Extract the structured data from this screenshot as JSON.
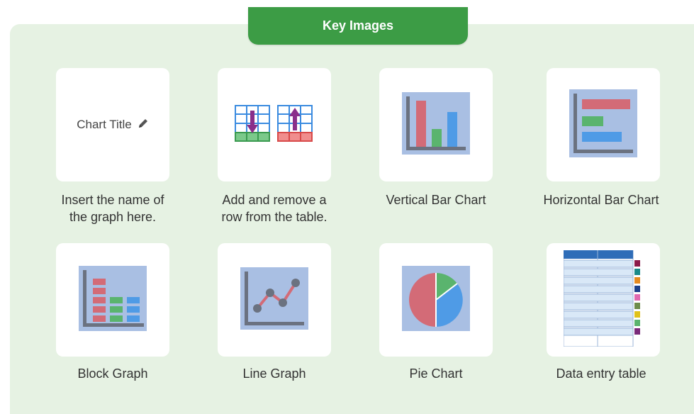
{
  "header": {
    "title": "Key Images"
  },
  "cards": [
    {
      "icon": "pencil-icon",
      "preview_text": "Chart Title",
      "caption_line1": "Insert the name of",
      "caption_line2": "the graph here."
    },
    {
      "icon": "add-remove-row-icon",
      "caption_line1": "Add and remove a",
      "caption_line2": "row from the table."
    },
    {
      "icon": "vertical-bar-chart-icon",
      "caption_line1": "Vertical Bar Chart",
      "caption_line2": ""
    },
    {
      "icon": "horizontal-bar-chart-icon",
      "caption_line1": "Horizontal Bar Chart",
      "caption_line2": ""
    },
    {
      "icon": "block-graph-icon",
      "caption_line1": "Block Graph",
      "caption_line2": ""
    },
    {
      "icon": "line-graph-icon",
      "caption_line1": "Line Graph",
      "caption_line2": ""
    },
    {
      "icon": "pie-chart-icon",
      "caption_line1": "Pie Chart",
      "caption_line2": ""
    },
    {
      "icon": "data-entry-table-icon",
      "caption_line1": "Data entry table",
      "caption_line2": ""
    }
  ],
  "colors": {
    "header_green": "#3c9c45",
    "panel_bg": "#e6f2e3",
    "icon_bg": "#a9bfe3",
    "red": "#d36b77",
    "green": "#5ab46e",
    "blue": "#4f9be6",
    "axis": "#6b7280"
  }
}
